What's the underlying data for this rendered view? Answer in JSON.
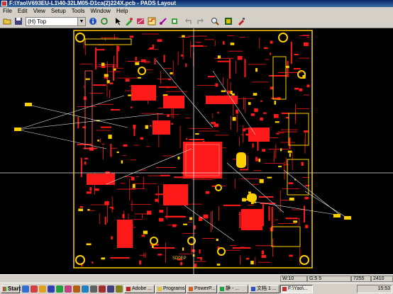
{
  "window": {
    "title": "F:\\Yao\\V693EU-L1\\40-32LM05-D1ca(2)224X.pcb - PADS Layout"
  },
  "menu": [
    "File",
    "Edit",
    "View",
    "Setup",
    "Tools",
    "Window",
    "Help"
  ],
  "toolbar": {
    "layer_select": "(H) Top",
    "icons": [
      "open-icon",
      "save-icon",
      "info-icon",
      "refresh-icon",
      "select-icon",
      "design-toolbar-icon",
      "drafting-toolbar-icon",
      "route-icon",
      "ecm-icon",
      "dimensioning-icon",
      "undo-icon",
      "redo-icon",
      "zoom-icon",
      "board-icon",
      "paint-icon"
    ]
  },
  "canvas": {
    "background": "#000000",
    "trace_color": "#ff1a1a",
    "copper_color": "#ffd000",
    "ratsnest_color": "#e6e6e6",
    "silk_label": "SD0EP"
  },
  "status": {
    "width": "W:10",
    "grid": "G:5 5",
    "x": "7255",
    "y": "2410"
  },
  "taskbar": {
    "start": "Start",
    "tasks": [
      {
        "label": "Adobe ...",
        "active": false
      },
      {
        "label": "Programs",
        "active": false
      },
      {
        "label": "PowerP...",
        "active": false
      },
      {
        "label": "静 - ...",
        "active": false
      },
      {
        "label": "文档 1 ...",
        "active": false
      },
      {
        "label": "F:\\Yao\\...",
        "active": true
      }
    ],
    "clock": "15:53"
  }
}
